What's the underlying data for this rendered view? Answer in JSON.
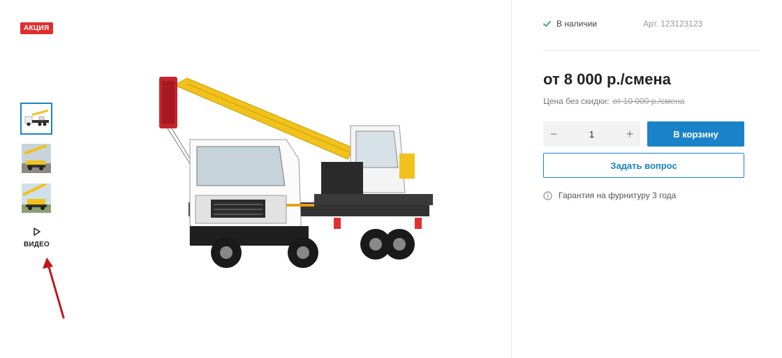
{
  "badge": {
    "label": "АКЦИЯ",
    "color": "#e02d2d"
  },
  "gallery": {
    "thumbnails": [
      {
        "name": "crane-thumb-1",
        "active": true
      },
      {
        "name": "crane-thumb-2",
        "active": false
      },
      {
        "name": "crane-thumb-3",
        "active": false
      }
    ],
    "video_label": "ВИДЕО",
    "video_icon": "play-icon",
    "annotation_icon": "red-arrow-icon"
  },
  "product": {
    "stock": "В наличии",
    "stock_icon": "check-icon",
    "sku": "Арт. 123123123",
    "price": "от 8 000 р./смена",
    "old_price_label": "Цена без скидки:",
    "old_price": "от 10 000 р./смена",
    "quantity": "1",
    "minus": "−",
    "plus": "+",
    "add_to_cart": "В корзину",
    "ask_question": "Задать вопрос",
    "warranty": "Гарантия на фурнитуру 3 года",
    "warranty_icon": "info-icon"
  },
  "colors": {
    "accent": "#1a82c8",
    "badge": "#e02d2d",
    "stock_check": "#2eaa4a",
    "crane_yellow": "#f2c21c"
  }
}
